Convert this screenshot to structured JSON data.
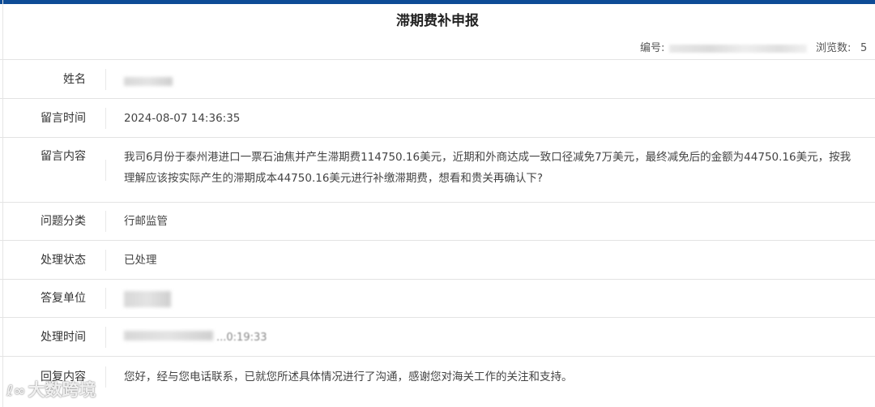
{
  "title": "滞期费补申报",
  "meta": {
    "serial_label": "编号:",
    "views_label": "浏览数:",
    "views_count": "5"
  },
  "fields": [
    {
      "label": "姓名",
      "value": ""
    },
    {
      "label": "留言时间",
      "value": "2024-08-07 14:36:35"
    },
    {
      "label": "留言内容",
      "value": "我司6月份于泰州港进口一票石油焦并产生滞期费114750.16美元，近期和外商达成一致口径减免7万美元，最终减免后的金额为44750.16美元，按我理解应该按实际产生的滞期成本44750.16美元进行补缴滞期费，想看和贵关再确认下?"
    },
    {
      "label": "问题分类",
      "value": "行邮监管"
    },
    {
      "label": "处理状态",
      "value": "已处理"
    },
    {
      "label": "答复单位",
      "value": ""
    },
    {
      "label": "处理时间",
      "value": "...0:19:33"
    },
    {
      "label": "回复内容",
      "value": "您好，经与您电话联系，已就您所述具体情况进行了沟通，感谢您对海关工作的关注和支持。"
    }
  ],
  "watermark": "大数跨境",
  "colors": {
    "accent": "#0e4c96",
    "divider": "#e3e3e3"
  }
}
